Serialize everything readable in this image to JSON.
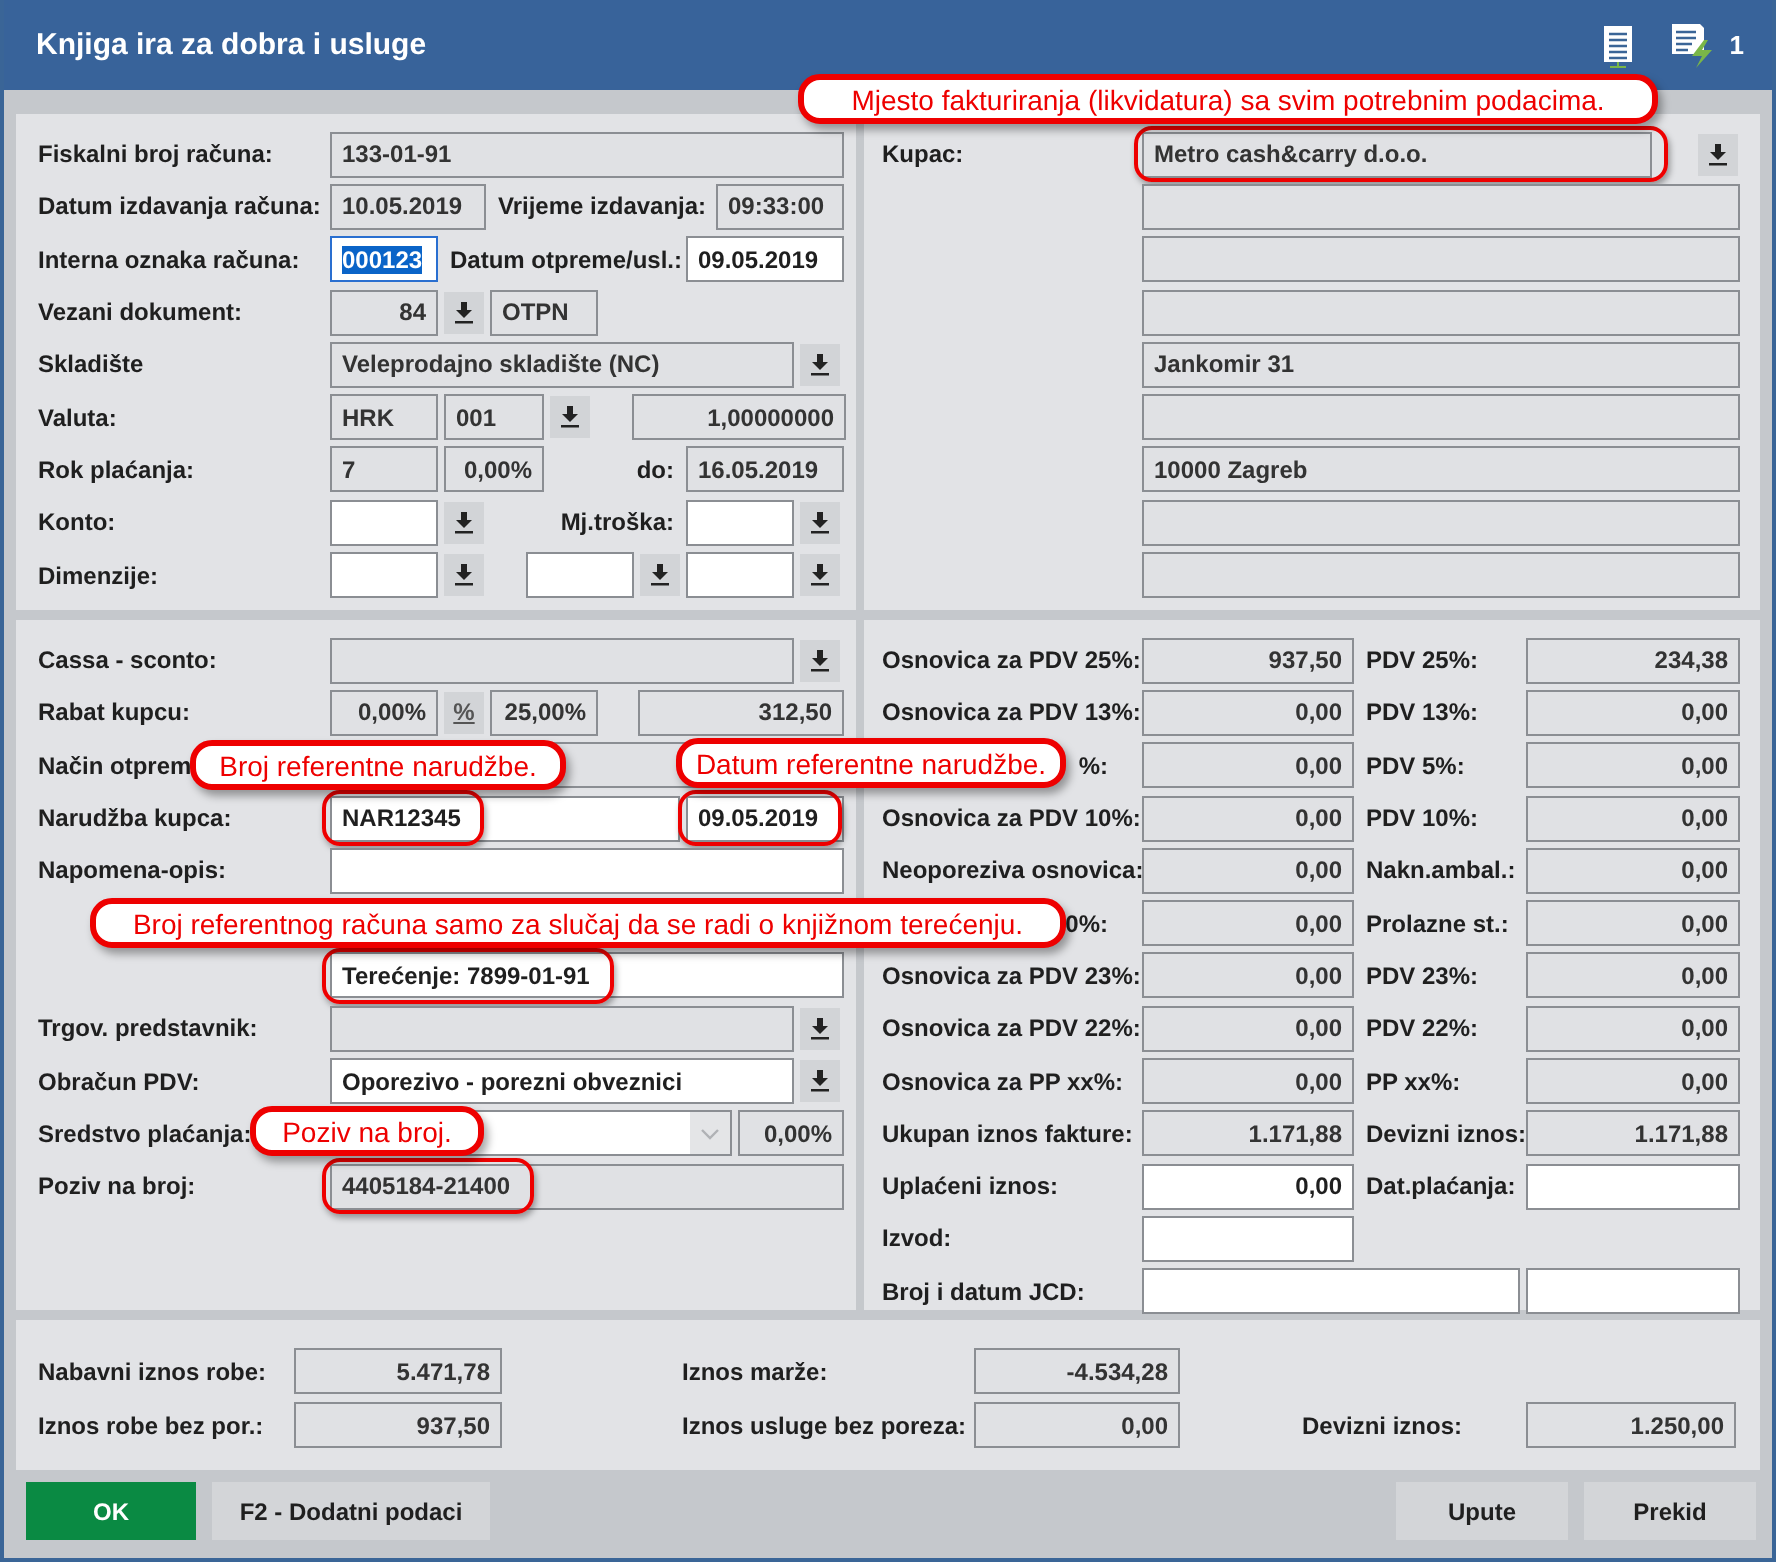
{
  "window": {
    "title": "Knjiga ira za dobra i usluge",
    "badge": "1"
  },
  "top_left": {
    "rows": [
      {
        "label": "Fiskalni broj računa:",
        "controls": [
          {
            "kind": "field",
            "value": "133-01-91",
            "editable": false,
            "highlighted": false,
            "focused": false
          }
        ]
      },
      {
        "label": "Datum izdavanja računa:",
        "controls": [
          {
            "kind": "field",
            "value": "10.05.2019",
            "editable": false,
            "highlighted": false,
            "focused": false
          },
          {
            "kind": "label",
            "text": "Vrijeme izdavanja:"
          },
          {
            "kind": "field",
            "value": "09:33:00",
            "editable": false,
            "highlighted": false,
            "focused": false
          }
        ]
      },
      {
        "label": "Interna oznaka računa:",
        "controls": [
          {
            "kind": "field",
            "value": "000123",
            "editable": true,
            "highlighted": false,
            "focused": true
          },
          {
            "kind": "label",
            "text": "Datum otpreme/usl.:"
          },
          {
            "kind": "field",
            "value": "09.05.2019",
            "editable": true,
            "highlighted": false,
            "focused": false
          }
        ]
      },
      {
        "label": "Vezani dokument:",
        "controls": [
          {
            "kind": "field",
            "value": "84",
            "editable": false,
            "highlighted": false,
            "focused": false
          },
          {
            "kind": "button"
          },
          {
            "kind": "field",
            "value": "OTPN",
            "editable": false,
            "highlighted": false,
            "focused": false
          }
        ]
      },
      {
        "label": "Skladište",
        "controls": [
          {
            "kind": "field",
            "value": "Veleprodajno skladište (NC)",
            "editable": false,
            "highlighted": false,
            "focused": false
          },
          {
            "kind": "button"
          }
        ]
      },
      {
        "label": "Valuta:",
        "controls": [
          {
            "kind": "field",
            "value": "HRK",
            "editable": false,
            "highlighted": false,
            "focused": false
          },
          {
            "kind": "field",
            "value": "001",
            "editable": false,
            "highlighted": false,
            "focused": false
          },
          {
            "kind": "button"
          },
          {
            "kind": "field",
            "value": "1,00000000",
            "editable": false,
            "highlighted": false,
            "focused": false
          }
        ]
      },
      {
        "label": "Rok plaćanja:",
        "controls": [
          {
            "kind": "field",
            "value": "7",
            "editable": false,
            "highlighted": false,
            "focused": false
          },
          {
            "kind": "field",
            "value": "0,00%",
            "editable": false,
            "highlighted": false,
            "focused": false
          },
          {
            "kind": "label",
            "text": "do:"
          },
          {
            "kind": "field",
            "value": "16.05.2019",
            "editable": false,
            "highlighted": false,
            "focused": false
          }
        ]
      },
      {
        "label": "Konto:",
        "controls": [
          {
            "kind": "field",
            "editable": true,
            "highlighted": false,
            "focused": false
          },
          {
            "kind": "button"
          },
          {
            "kind": "label",
            "text": "Mj.troška:"
          },
          {
            "kind": "field",
            "editable": true,
            "highlighted": false,
            "focused": false
          },
          {
            "kind": "button"
          }
        ]
      },
      {
        "label": "Dimenzije:",
        "controls": [
          {
            "kind": "field",
            "editable": true,
            "highlighted": false,
            "focused": false
          },
          {
            "kind": "button"
          },
          {
            "kind": "field",
            "editable": true,
            "highlighted": false,
            "focused": false
          },
          {
            "kind": "button"
          },
          {
            "kind": "field",
            "editable": true,
            "highlighted": false,
            "focused": false
          },
          {
            "kind": "button"
          }
        ]
      }
    ]
  },
  "customer": {
    "label": "Kupac:",
    "name_field": {
      "value": "Metro cash&carry d.o.o.",
      "editable": false,
      "highlighted": true
    },
    "address_fields": [
      {
        "editable": false,
        "highlighted": false
      },
      {
        "editable": false,
        "highlighted": false
      },
      {
        "editable": false,
        "highlighted": false
      },
      {
        "value": "Jankomir 31",
        "editable": false,
        "highlighted": false
      },
      {
        "editable": false,
        "highlighted": false
      },
      {
        "value": "10000 Zagreb",
        "editable": false,
        "highlighted": false
      },
      {
        "editable": false,
        "highlighted": false
      },
      {
        "editable": false,
        "highlighted": false
      }
    ]
  },
  "middle_left": {
    "rows": [
      {
        "label": "Cassa - sconto:",
        "controls": [
          {
            "kind": "field",
            "editable": false,
            "highlighted": false
          },
          {
            "kind": "button"
          }
        ]
      },
      {
        "label": "Rabat kupcu:",
        "controls": [
          {
            "kind": "field",
            "value": "0,00%",
            "editable": false,
            "highlighted": false
          },
          {
            "kind": "toggle",
            "text": "%"
          },
          {
            "kind": "field",
            "value": "25,00%",
            "editable": false,
            "highlighted": false
          },
          {
            "kind": "field",
            "value": "312,50",
            "editable": false,
            "highlighted": false
          }
        ]
      },
      {
        "label": "Način otprem",
        "controls": [
          {
            "kind": "field",
            "editable": false,
            "highlighted": false
          }
        ]
      },
      {
        "label": "Narudžba kupca:",
        "controls": [
          {
            "kind": "field",
            "value": "NAR12345",
            "editable": true,
            "highlighted": true
          },
          {
            "kind": "field",
            "value": "09.05.2019",
            "editable": true,
            "highlighted": true
          }
        ]
      },
      {
        "label": "Napomena-opis:",
        "controls": [
          {
            "kind": "field",
            "editable": true,
            "highlighted": false
          }
        ]
      }
    ],
    "reference_field": {
      "value": "Terećenje: 7899-01-91",
      "editable": true,
      "highlighted": true
    },
    "lower_rows": [
      {
        "label": "Trgov. predstavnik:",
        "controls": [
          {
            "kind": "field",
            "editable": false,
            "highlighted": false
          },
          {
            "kind": "button"
          }
        ]
      },
      {
        "label": "Obračun PDV:",
        "controls": [
          {
            "kind": "field",
            "value": "Oporezivo - porezni obveznici",
            "editable": true,
            "highlighted": false
          },
          {
            "kind": "button"
          }
        ]
      },
      {
        "label": "Sredstvo plaćanja:",
        "controls": [
          {
            "kind": "select",
            "editable": true,
            "highlighted": false
          },
          {
            "kind": "field",
            "value": "0,00%",
            "editable": false,
            "highlighted": false
          }
        ]
      },
      {
        "label": "Poziv na broj:",
        "controls": [
          {
            "kind": "field",
            "value": "4405184-21400",
            "editable": false,
            "highlighted": true
          }
        ]
      }
    ]
  },
  "middle_right": {
    "rows": [
      {
        "kind": "pair",
        "label": "Osnovica za PDV 25%:",
        "value": "937,50",
        "editable": false,
        "label2": "PDV 25%:",
        "value2": "234,38",
        "editable2": false
      },
      {
        "kind": "pair",
        "label": "Osnovica za PDV 13%:",
        "value": "0,00",
        "editable": false,
        "label2": "PDV 13%:",
        "value2": "0,00",
        "editable2": false
      },
      {
        "kind": "pair",
        "label": "%:",
        "covered": true,
        "value": "0,00",
        "editable": false,
        "label2": "PDV 5%:",
        "value2": "0,00",
        "editable2": false
      },
      {
        "kind": "pair",
        "label": "Osnovica za PDV 10%:",
        "value": "0,00",
        "editable": false,
        "label2": "PDV 10%:",
        "value2": "0,00",
        "editable2": false
      },
      {
        "kind": "pair",
        "label": "Neoporeziva osnovica:",
        "value": "0,00",
        "editable": false,
        "label2": "Nakn.ambal.:",
        "value2": "0,00",
        "editable2": false
      },
      {
        "kind": "pair",
        "label": "0%:",
        "covered": true,
        "value": "0,00",
        "editable": false,
        "label2": "Prolazne st.:",
        "value2": "0,00",
        "editable2": false
      },
      {
        "kind": "pair",
        "label": "Osnovica za PDV 23%:",
        "value": "0,00",
        "editable": false,
        "label2": "PDV 23%:",
        "value2": "0,00",
        "editable2": false
      },
      {
        "kind": "pair",
        "label": "Osnovica za PDV 22%:",
        "value": "0,00",
        "editable": false,
        "label2": "PDV 22%:",
        "value2": "0,00",
        "editable2": false
      },
      {
        "kind": "pair",
        "label": "Osnovica za PP xx%:",
        "value": "0,00",
        "editable": false,
        "label2": "PP xx%:",
        "value2": "0,00",
        "editable2": false
      },
      {
        "kind": "pair",
        "label": "Ukupan iznos fakture:",
        "value": "1.171,88",
        "editable": false,
        "label2": "Devizni iznos:",
        "value2": "1.171,88",
        "editable2": false
      },
      {
        "kind": "pair",
        "label": "Uplaćeni iznos:",
        "value": "0,00",
        "editable": true,
        "label2": "Dat.plaćanja:",
        "editable2": true
      },
      {
        "kind": "single",
        "label": "Izvod:",
        "editable": true
      },
      {
        "kind": "wide",
        "label": "Broj i datum JCD:",
        "editable": true,
        "editable2": true
      }
    ]
  },
  "totals": {
    "rows": [
      [
        {
          "label": "Nabavni iznos robe:",
          "value": "5.471,78"
        },
        {
          "label": "Iznos marže:",
          "value": "-4.534,28"
        }
      ],
      [
        {
          "label": "Iznos robe bez por.:",
          "value": "937,50"
        },
        {
          "label": "Iznos usluge bez poreza:",
          "value": "0,00"
        },
        {
          "label": "Devizni iznos:",
          "value": "1.250,00"
        }
      ]
    ]
  },
  "buttons": [
    {
      "label": "OK",
      "primary": true
    },
    {
      "label": "F2 - Dodatni podaci",
      "primary": false
    },
    {
      "label": "Upute",
      "primary": false
    },
    {
      "label": "Prekid",
      "primary": false
    }
  ],
  "callouts": [
    {
      "text": "Mjesto fakturiranja (likvidatura) sa svim potrebnim podacima."
    },
    {
      "text": "Broj referentne narudžbe."
    },
    {
      "text": "Datum referentne narudžbe."
    },
    {
      "text": "Broj referentnog računa samo za slučaj da se radi o knjižnom terećenju."
    },
    {
      "text": "Poziv na broj."
    }
  ]
}
